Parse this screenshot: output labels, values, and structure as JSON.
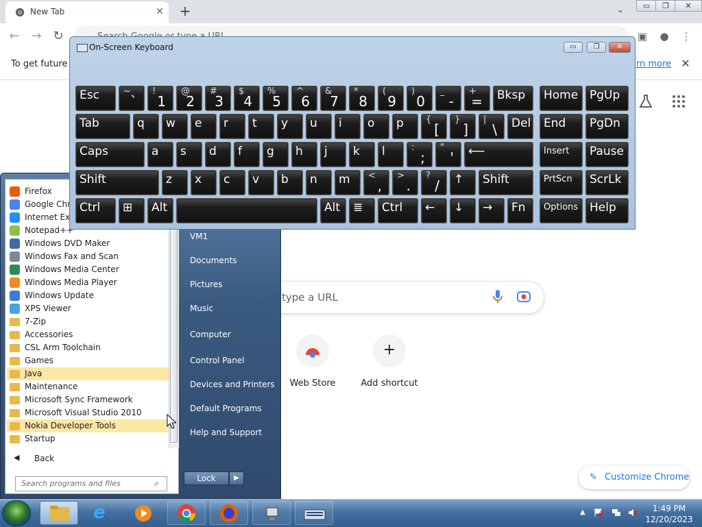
{
  "browser": {
    "tab_title": "New Tab",
    "tab_close": "✕",
    "new_tab": "+",
    "omnibox_placeholder": "Search Google or type a URL",
    "infobar_text": "To get future G",
    "infobar_link": "arn more",
    "infobar_close": "✕",
    "ntp_search_placeholder": "type a URL",
    "shortcuts": [
      {
        "label": "Web Store"
      },
      {
        "label": "Add shortcut",
        "symbol": "+"
      }
    ],
    "customize_label": "Customize Chrome"
  },
  "window_controls": {
    "minimize": "▭",
    "restore": "❐",
    "close": "✕"
  },
  "start_menu": {
    "programs": [
      {
        "label": "Firefox",
        "icon": "firefox-icon",
        "color": "#e66000"
      },
      {
        "label": "Google Chro",
        "icon": "chrome-icon",
        "color": "#4285f4"
      },
      {
        "label": "Internet Exple",
        "icon": "ie-icon",
        "color": "#1e90ff"
      },
      {
        "label": "Notepad++",
        "icon": "notepadpp-icon",
        "color": "#8bc34a"
      },
      {
        "label": "Windows DVD Maker",
        "icon": "dvd-maker-icon",
        "color": "#3a6ea5"
      },
      {
        "label": "Windows Fax and Scan",
        "icon": "fax-icon",
        "color": "#7d8a96"
      },
      {
        "label": "Windows Media Center",
        "icon": "media-center-icon",
        "color": "#2e8b57"
      },
      {
        "label": "Windows Media Player",
        "icon": "media-player-icon",
        "color": "#f08a24"
      },
      {
        "label": "Windows Update",
        "icon": "windows-update-icon",
        "color": "#3b7dd8"
      },
      {
        "label": "XPS Viewer",
        "icon": "xps-viewer-icon",
        "color": "#4aa3df"
      },
      {
        "label": "7-Zip",
        "icon": "folder-icon",
        "color": "#e8b84a"
      },
      {
        "label": "Accessories",
        "icon": "folder-icon",
        "color": "#e8b84a"
      },
      {
        "label": "CSL Arm Toolchain",
        "icon": "folder-icon",
        "color": "#e8b84a"
      },
      {
        "label": "Games",
        "icon": "folder-icon",
        "color": "#e8b84a"
      },
      {
        "label": "Java",
        "icon": "folder-icon",
        "color": "#e8b84a",
        "highlighted": true
      },
      {
        "label": "Maintenance",
        "icon": "folder-icon",
        "color": "#e8b84a"
      },
      {
        "label": "Microsoft Sync Framework",
        "icon": "folder-icon",
        "color": "#e8b84a"
      },
      {
        "label": "Microsoft Visual Studio 2010",
        "icon": "folder-icon",
        "color": "#e8b84a"
      },
      {
        "label": "Nokia Developer Tools",
        "icon": "folder-icon",
        "color": "#e8b84a",
        "highlighted": true
      },
      {
        "label": "Startup",
        "icon": "folder-icon",
        "color": "#e8b84a"
      }
    ],
    "back_label": "Back",
    "search_placeholder": "Search programs and files",
    "right_items": [
      "VM1",
      "Documents",
      "Pictures",
      "Music",
      "Computer",
      "Control Panel",
      "Devices and Printers",
      "Default Programs",
      "Help and Support"
    ],
    "lock_label": "Lock",
    "lock_arrow": "▶"
  },
  "osk": {
    "title": "On-Screen Keyboard",
    "rows": [
      [
        {
          "label": "Esc"
        },
        {
          "shift": "~",
          "main": "`"
        },
        {
          "shift": "!",
          "main": "1"
        },
        {
          "shift": "@",
          "main": "2"
        },
        {
          "shift": "#",
          "main": "3"
        },
        {
          "shift": "$",
          "main": "4"
        },
        {
          "shift": "%",
          "main": "5"
        },
        {
          "shift": "^",
          "main": "6"
        },
        {
          "shift": "&",
          "main": "7"
        },
        {
          "shift": "*",
          "main": "8"
        },
        {
          "shift": "(",
          "main": "9"
        },
        {
          "shift": ")",
          "main": "0"
        },
        {
          "shift": "_",
          "main": "-"
        },
        {
          "shift": "+",
          "main": "="
        },
        {
          "label": "Bksp"
        },
        {
          "label": "Home"
        },
        {
          "label": "PgUp"
        }
      ],
      [
        {
          "label": "Tab"
        },
        {
          "label": "q"
        },
        {
          "label": "w"
        },
        {
          "label": "e"
        },
        {
          "label": "r"
        },
        {
          "label": "t"
        },
        {
          "label": "y"
        },
        {
          "label": "u"
        },
        {
          "label": "i"
        },
        {
          "label": "o"
        },
        {
          "label": "p"
        },
        {
          "shift": "{",
          "main": "["
        },
        {
          "shift": "}",
          "main": "]"
        },
        {
          "shift": "|",
          "main": "\\"
        },
        {
          "label": "Del"
        },
        {
          "label": "End"
        },
        {
          "label": "PgDn"
        }
      ],
      [
        {
          "label": "Caps"
        },
        {
          "label": "a"
        },
        {
          "label": "s"
        },
        {
          "label": "d"
        },
        {
          "label": "f"
        },
        {
          "label": "g"
        },
        {
          "label": "h"
        },
        {
          "label": "j"
        },
        {
          "label": "k"
        },
        {
          "label": "l"
        },
        {
          "shift": ":",
          "main": ";"
        },
        {
          "shift": "\"",
          "main": "'"
        },
        {
          "label": "⟵"
        },
        {
          "label": "Insert"
        },
        {
          "label": "Pause"
        }
      ],
      [
        {
          "label": "Shift"
        },
        {
          "label": "z"
        },
        {
          "label": "x"
        },
        {
          "label": "c"
        },
        {
          "label": "v"
        },
        {
          "label": "b"
        },
        {
          "label": "n"
        },
        {
          "label": "m"
        },
        {
          "shift": "<",
          "main": ","
        },
        {
          "shift": ">",
          "main": "."
        },
        {
          "shift": "?",
          "main": "/"
        },
        {
          "label": "↑"
        },
        {
          "label": "Shift"
        },
        {
          "label": "PrtScn"
        },
        {
          "label": "ScrLk"
        }
      ],
      [
        {
          "label": "Ctrl"
        },
        {
          "label": "⊞"
        },
        {
          "label": "Alt"
        },
        {
          "label": ""
        },
        {
          "label": "Alt"
        },
        {
          "label": "≣"
        },
        {
          "label": "Ctrl"
        },
        {
          "label": "←"
        },
        {
          "label": "↓"
        },
        {
          "label": "→"
        },
        {
          "label": "Fn"
        },
        {
          "label": "Options"
        },
        {
          "label": "Help"
        }
      ]
    ]
  },
  "taskbar": {
    "time": "1:49 PM",
    "date": "12/20/2023"
  }
}
